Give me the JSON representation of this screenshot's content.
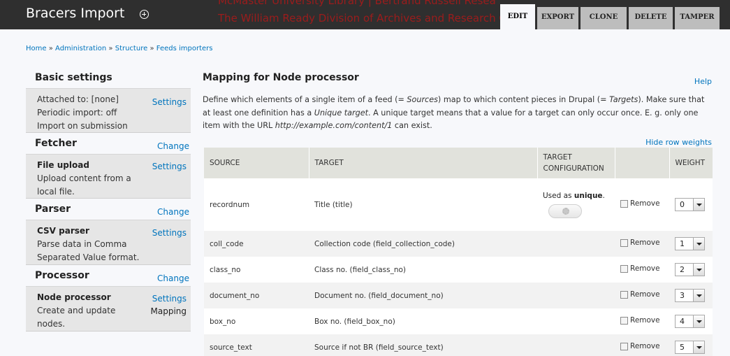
{
  "header": {
    "page_title": "Bracers Import",
    "bg_text_line1": "McMaster University Library | Bertrand Russell Resea",
    "bg_text_line2": "The William Ready Division of Archives and Research C",
    "tabs": [
      "EDIT",
      "EXPORT",
      "CLONE",
      "DELETE",
      "TAMPER"
    ]
  },
  "breadcrumb": {
    "items": [
      "Home",
      "Administration",
      "Structure",
      "Feeds importers"
    ],
    "separator": "»"
  },
  "sidebar": {
    "basic": {
      "title": "Basic settings",
      "lines": [
        "Attached to: [none]",
        "Periodic import: off",
        "Import on submission"
      ],
      "link": "Settings"
    },
    "fetcher": {
      "title": "Fetcher",
      "change": "Change",
      "name": "File upload",
      "lines": [
        "Upload content from a",
        "local file."
      ],
      "link": "Settings"
    },
    "parser": {
      "title": "Parser",
      "change": "Change",
      "name": "CSV parser",
      "lines": [
        "Parse data in Comma",
        "Separated Value format."
      ],
      "link": "Settings"
    },
    "processor": {
      "title": "Processor",
      "change": "Change",
      "name": "Node processor",
      "lines": [
        "Create and update",
        "nodes."
      ],
      "link": "Settings",
      "link2": "Mapping"
    }
  },
  "main": {
    "title": "Mapping for Node processor",
    "help": "Help",
    "desc": {
      "p1": "Define which elements of a single item of a feed (= ",
      "sources": "Sources",
      "p2": ") map to which content pieces in Drupal (= ",
      "targets": "Targets",
      "p3": "). Make sure that at least one definition has a ",
      "unique_target": "Unique target",
      "p4": ". A unique target means that a value for a target can only occur once. E. g. only one item with the URL ",
      "url": "http://example.com/content/1",
      "p5": " can exist."
    },
    "hide_weights": "Hide row weights",
    "columns": {
      "source": "SOURCE",
      "target": "TARGET",
      "config1": "TARGET",
      "config2": "CONFIGURATION",
      "weight": "WEIGHT"
    },
    "used_as": "Used as",
    "unique_word": "unique",
    "remove_label": "Remove",
    "rows": [
      {
        "source": "recordnum",
        "target": "Title (title)",
        "weight": "0"
      },
      {
        "source": "coll_code",
        "target": "Collection code (field_collection_code)",
        "weight": "1"
      },
      {
        "source": "class_no",
        "target": "Class no. (field_class_no)",
        "weight": "2"
      },
      {
        "source": "document_no",
        "target": "Document no. (field_document_no)",
        "weight": "3"
      },
      {
        "source": "box_no",
        "target": "Box no. (field_box_no)",
        "weight": "4"
      },
      {
        "source": "source_text",
        "target": "Source if not BR (field_source_text)",
        "weight": "5"
      }
    ]
  },
  "colors": {
    "header_bg": "#2f2f2f",
    "link": "#0074bd",
    "tab_bg": "#bdbdbd",
    "sidebar_box": "#e6e6e6",
    "table_head": "#e1e2dc"
  }
}
